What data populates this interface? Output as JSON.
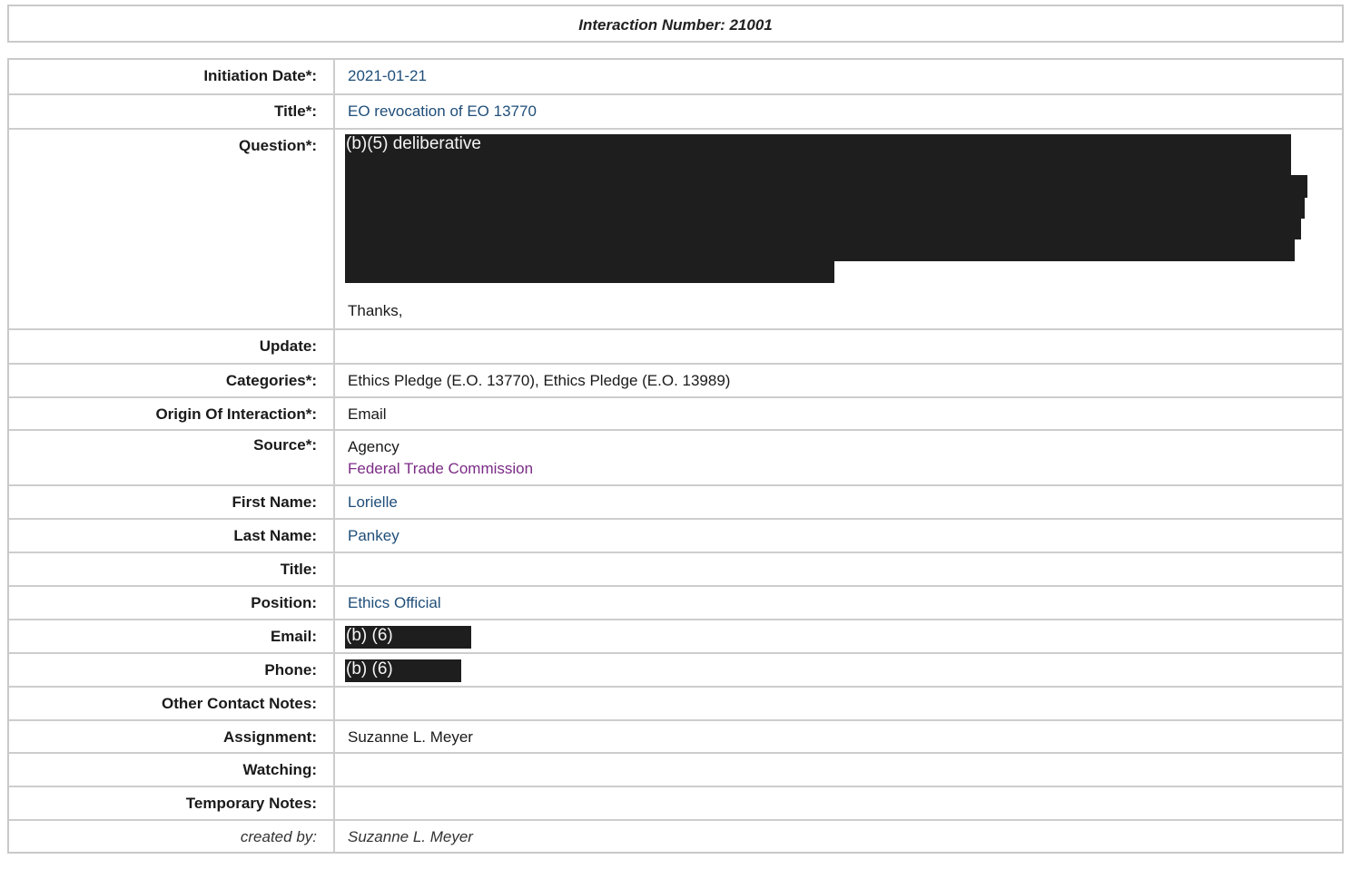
{
  "header": {
    "title": "Interaction Number: 21001"
  },
  "fields": {
    "initiation_date": {
      "label": "Initiation Date*:",
      "value": "2021-01-21"
    },
    "title": {
      "label": "Title*:",
      "value": "EO revocation of EO 13770"
    },
    "question": {
      "label": "Question*:",
      "redaction_label": "(b)(5) deliberative",
      "closing": "Thanks,"
    },
    "update": {
      "label": "Update:",
      "value": ""
    },
    "categories": {
      "label": "Categories*:",
      "value": "Ethics Pledge (E.O. 13770), Ethics Pledge (E.O. 13989)"
    },
    "origin": {
      "label": "Origin Of Interaction*:",
      "value": "Email"
    },
    "source": {
      "label": "Source*:",
      "value": "Agency",
      "agency": "Federal Trade Commission"
    },
    "first_name": {
      "label": "First Name:",
      "value": "Lorielle"
    },
    "last_name": {
      "label": "Last Name:",
      "value": "Pankey"
    },
    "contact_title": {
      "label": "Title:",
      "value": ""
    },
    "position": {
      "label": "Position:",
      "value": "Ethics Official"
    },
    "email": {
      "label": "Email:",
      "redaction_label": "(b) (6)"
    },
    "phone": {
      "label": "Phone:",
      "redaction_label": "(b) (6)"
    },
    "other_contact_notes": {
      "label": "Other Contact Notes:",
      "value": ""
    },
    "assignment": {
      "label": "Assignment:",
      "value": "Suzanne L. Meyer"
    },
    "watching": {
      "label": "Watching:",
      "value": ""
    },
    "temporary_notes": {
      "label": "Temporary Notes:",
      "value": ""
    },
    "created_by": {
      "label": "created by:",
      "value": "Suzanne L. Meyer"
    }
  }
}
